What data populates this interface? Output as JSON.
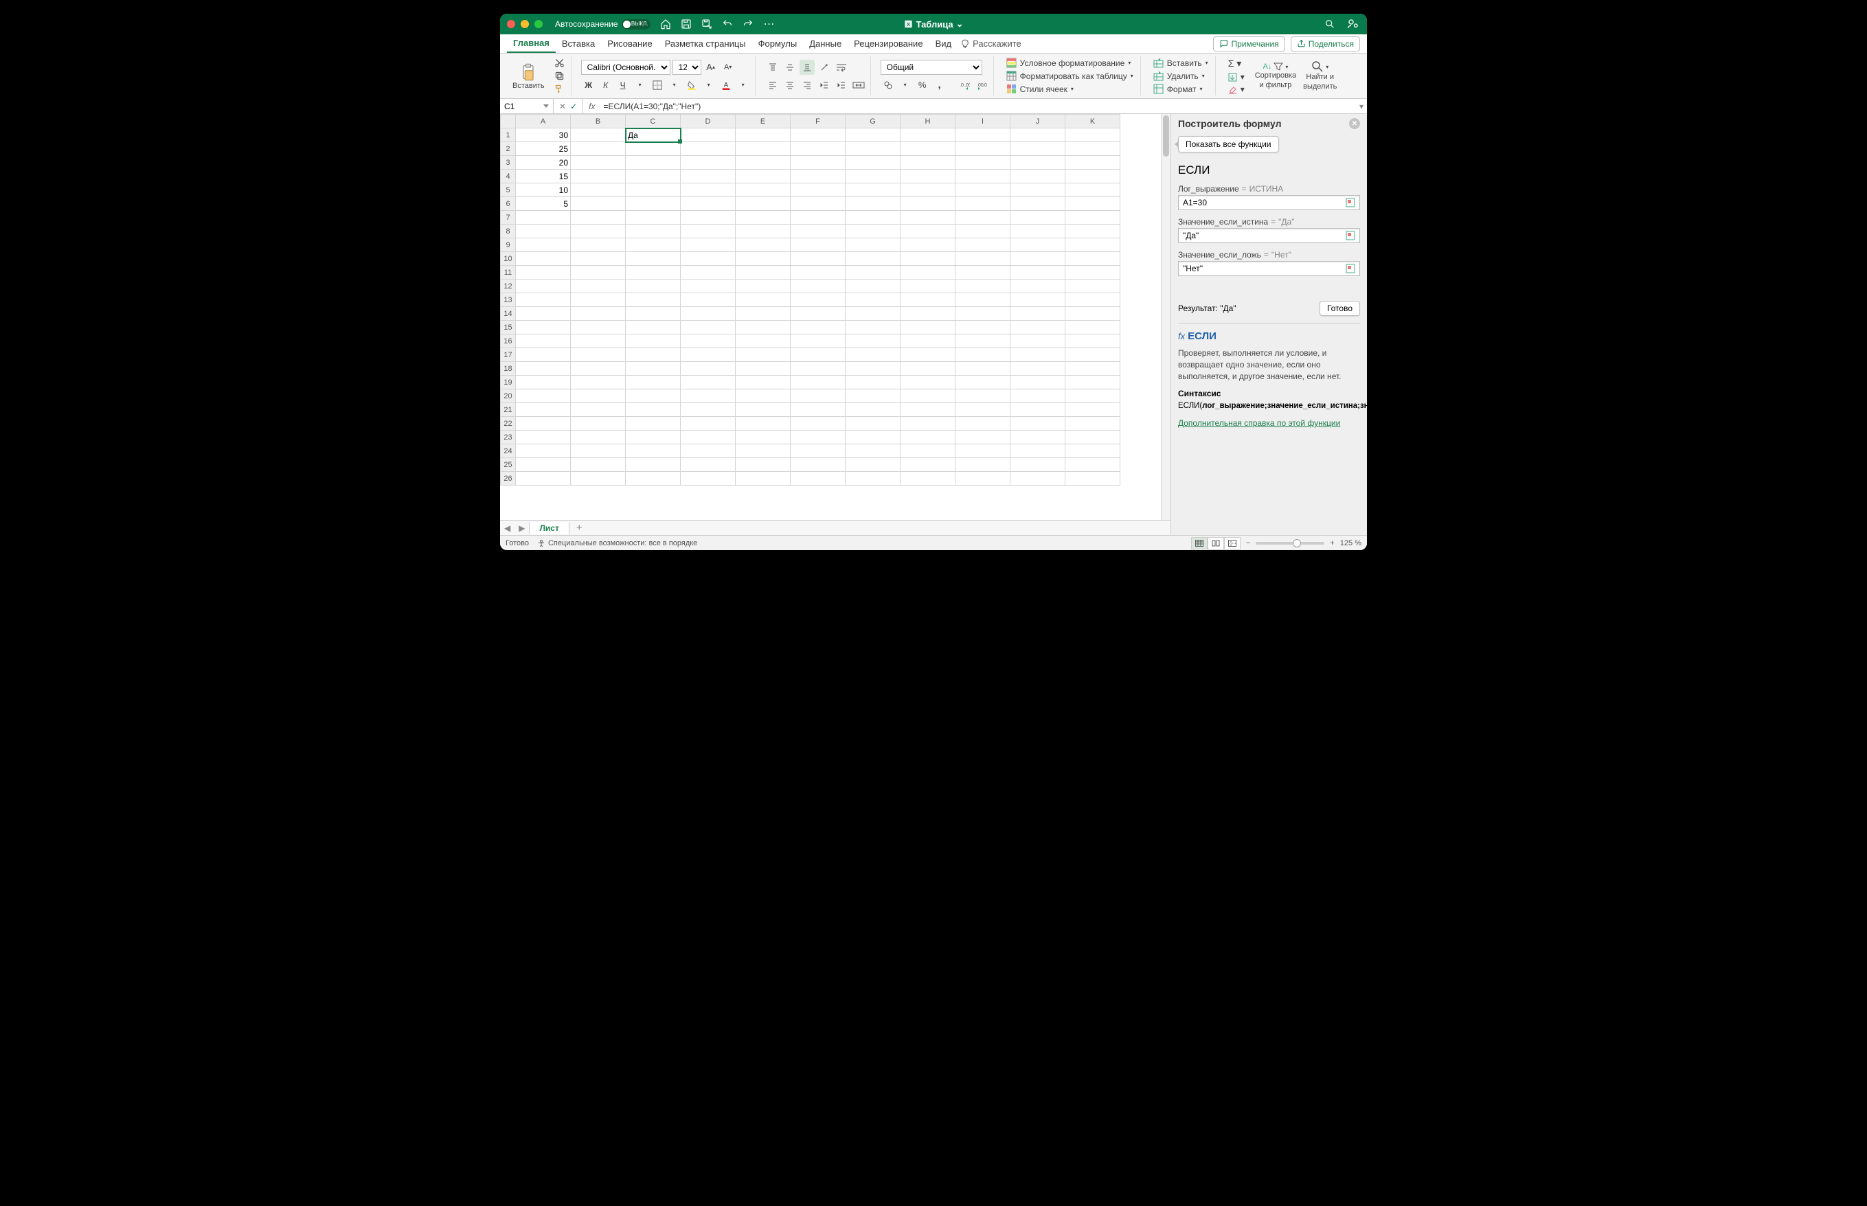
{
  "titlebar": {
    "autosave_label": "Автосохранение",
    "autosave_state": "ВЫКЛ.",
    "doc_title": "Таблица"
  },
  "tabs": {
    "items": [
      "Главная",
      "Вставка",
      "Рисование",
      "Разметка страницы",
      "Формулы",
      "Данные",
      "Рецензирование",
      "Вид"
    ],
    "tell_me": "Расскажите",
    "comments": "Примечания",
    "share": "Поделиться"
  },
  "ribbon": {
    "paste": "Вставить",
    "font_name": "Calibri (Основной...",
    "font_size": "12",
    "bold": "Ж",
    "italic": "К",
    "underline": "Ч",
    "number_format": "Общий",
    "cond_fmt": "Условное форматирование",
    "as_table": "Форматировать как таблицу",
    "cell_styles": "Стили ячеек",
    "insert": "Вставить",
    "delete": "Удалить",
    "format": "Формат",
    "sort_filter": "Сортировка\nи фильтр",
    "find_select": "Найти и\nвыделить"
  },
  "fbar": {
    "cell": "C1",
    "formula": "=ЕСЛИ(A1=30;\"Да\";\"Нет\")"
  },
  "grid": {
    "cols": [
      "A",
      "B",
      "C",
      "D",
      "E",
      "F",
      "G",
      "H",
      "I",
      "J",
      "K"
    ],
    "row_count": 26,
    "selected": "C1",
    "cells": {
      "A1": "30",
      "A2": "25",
      "A3": "20",
      "A4": "15",
      "A5": "10",
      "A6": "5",
      "C1": "Да"
    }
  },
  "sheet": {
    "tab": "Лист"
  },
  "pane": {
    "title": "Построитель формул",
    "show_all": "Показать все функции",
    "fn": "ЕСЛИ",
    "args": [
      {
        "label": "Лог_выражение",
        "eq": "=",
        "preview": "ИСТИНА",
        "value": "A1=30"
      },
      {
        "label": "Значение_если_истина",
        "eq": "=",
        "preview": "\"Да\"",
        "value": "\"Да\""
      },
      {
        "label": "Значение_если_ложь",
        "eq": "=",
        "preview": "\"Нет\"",
        "value": "\"Нет\""
      }
    ],
    "result_label": "Результат:",
    "result_value": "\"Да\"",
    "done": "Готово",
    "help_fn": "ЕСЛИ",
    "help_desc": "Проверяет, выполняется ли условие, и возвращает одно значение, если оно выполняется, и другое значение, если нет.",
    "syntax_title": "Синтаксис",
    "syntax_body_fn": "ЕСЛИ(",
    "syntax_body_args": "лог_выражение;значение_если_истина;значение_если_ложь",
    "syntax_body_close": ")",
    "help_link": "Дополнительная справка по этой функции"
  },
  "status": {
    "ready": "Готово",
    "access": "Специальные возможности: все в порядке",
    "zoom": "125 %"
  }
}
